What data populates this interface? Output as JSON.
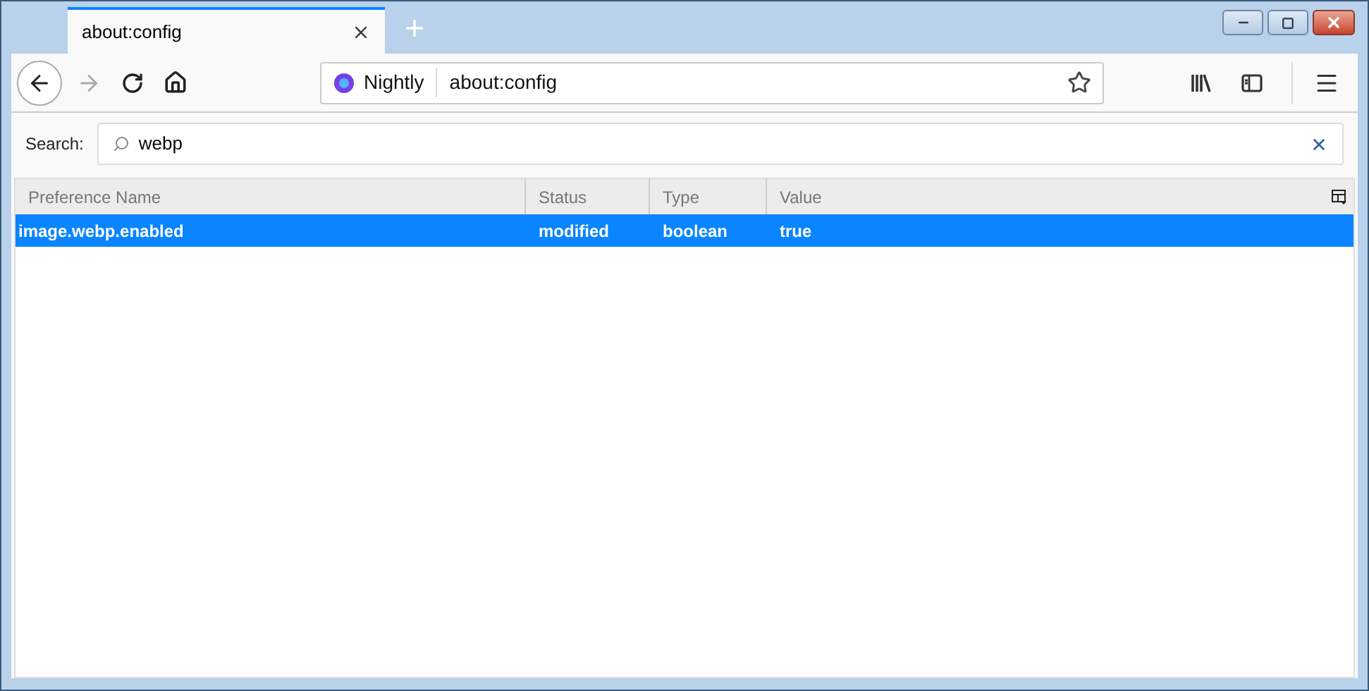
{
  "tabs": [
    {
      "title": "about:config",
      "selected": true
    }
  ],
  "new_tab": "+",
  "urlbar": {
    "identity": "Nightly",
    "url": "about:config"
  },
  "search": {
    "label": "Search:",
    "value": "webp"
  },
  "table": {
    "columns": [
      "Preference Name",
      "Status",
      "Type",
      "Value"
    ],
    "rows": [
      {
        "cells": [
          "image.webp.enabled",
          "modified",
          "boolean",
          "true"
        ],
        "selected": true
      }
    ]
  }
}
